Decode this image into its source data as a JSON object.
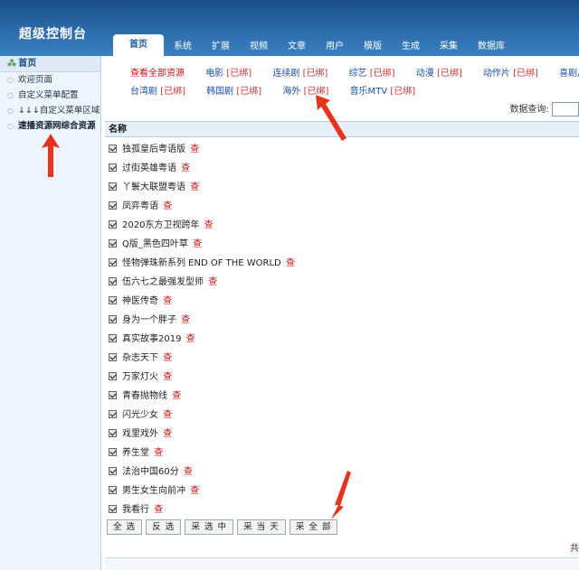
{
  "app": {
    "title": "超级控制台"
  },
  "tabs": [
    "首页",
    "系统",
    "扩展",
    "视频",
    "文章",
    "用户",
    "模版",
    "生成",
    "采集",
    "数据库"
  ],
  "sidebar": {
    "header": "首页",
    "items": [
      "欢迎页面",
      "自定义菜单配置",
      "↓↓↓自定义菜单区域↓↓↓",
      "速播资源网综合资源"
    ]
  },
  "filters": {
    "row1": [
      {
        "label": "查看全部资源",
        "tag": ""
      },
      {
        "label": "电影 ",
        "tag": "[已绑]"
      },
      {
        "label": "连续剧 ",
        "tag": "[已绑]"
      },
      {
        "label": "综艺 ",
        "tag": "[已绑]"
      },
      {
        "label": "动漫 ",
        "tag": "[已绑]"
      },
      {
        "label": "动作片 ",
        "tag": "[已绑]"
      },
      {
        "label": "喜剧片",
        "tag": ""
      }
    ],
    "row2": [
      {
        "label": "台湾剧 ",
        "tag": "[已绑]"
      },
      {
        "label": "韩国剧 ",
        "tag": "[已绑]"
      },
      {
        "label": "海外 ",
        "tag": "[已绑]"
      },
      {
        "label": "音乐MTV ",
        "tag": "[已绑]"
      }
    ]
  },
  "search": {
    "label": "数据查询:"
  },
  "table": {
    "header": "名称",
    "view_label": "查",
    "rows": [
      "独孤皇后粤语版",
      "过街英雄粤语",
      "丫鬟大联盟粤语",
      "凤弈粤语",
      "2020东方卫视跨年",
      "Q版_黑色四叶草",
      "怪物弹珠新系列 END OF THE WORLD",
      "伍六七之最强发型师",
      "神医传奇",
      "身为一个胖子",
      "真实故事2019",
      "杂志天下",
      "万家灯火",
      "青春抛物线",
      "闪光少女",
      "戏里戏外",
      "养生堂",
      "法治中国60分",
      "男生女生向前冲",
      "我看行"
    ]
  },
  "buttons": [
    "全 选",
    "反 选",
    "采 选 中",
    "采 当 天",
    "采 全 部"
  ],
  "footer": {
    "char": "共"
  },
  "colors": {
    "header_blue": "#2c6cab",
    "link_blue": "#1a4fb0",
    "red": "#d01010",
    "arrow_red": "#e8331c"
  }
}
